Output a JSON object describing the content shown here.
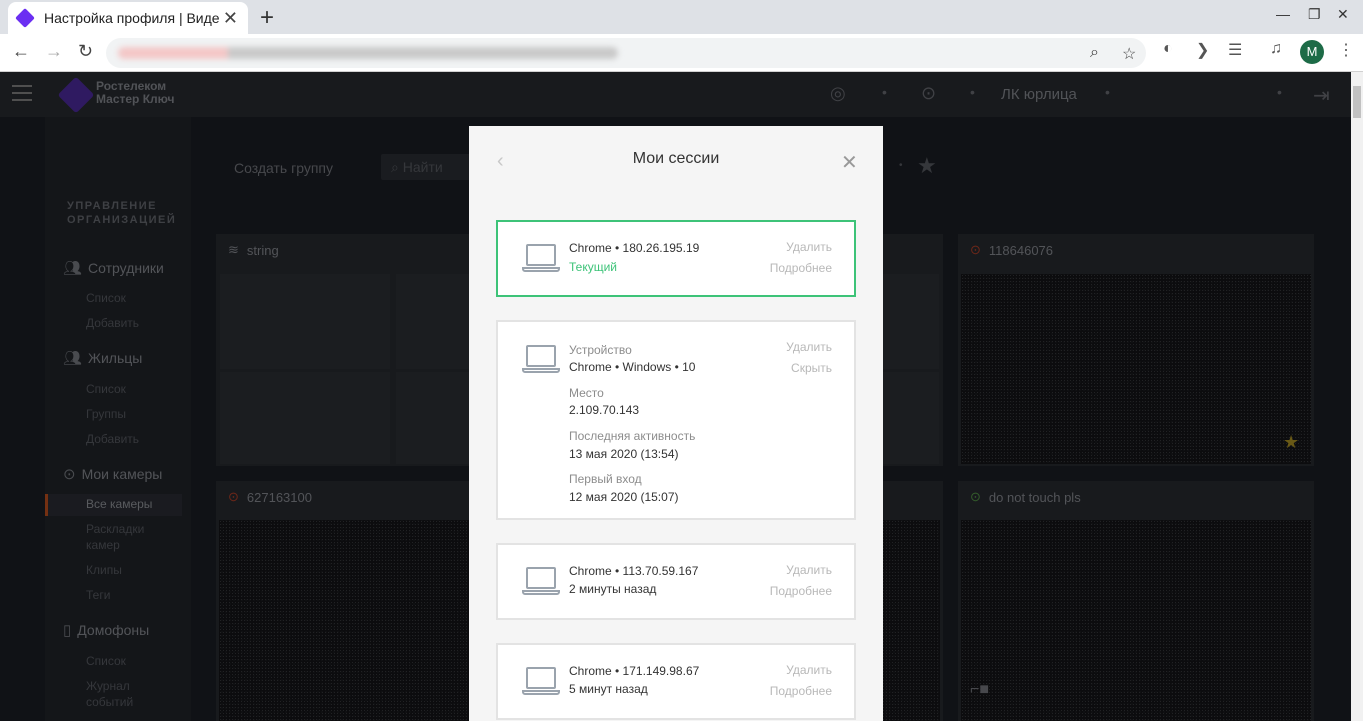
{
  "browser": {
    "tab_title": "Настройка профиля | Видеонаблюдение",
    "tab_close": "✕",
    "new_tab": "+",
    "account_initial": "M"
  },
  "app": {
    "logo_line1": "Ростелеком",
    "logo_line2": "Мастер Ключ",
    "org_label": "ЛК юрлица",
    "header_icons": [
      "support-icon",
      "camera-icon",
      "logout-icon"
    ]
  },
  "sidebar": {
    "section_title_1": "УПРАВЛЕНИЕ",
    "section_title_2": "ОРГАНИЗАЦИЕЙ",
    "employees": {
      "label": "Сотрудники",
      "items": [
        "Список",
        "Добавить"
      ]
    },
    "residents": {
      "label": "Жильцы",
      "items": [
        "Список",
        "Группы",
        "Добавить"
      ]
    },
    "cameras": {
      "label": "Мои камеры",
      "items": [
        "Все камеры",
        "Раскладки",
        "камер",
        "Клипы",
        "Теги"
      ]
    },
    "intercoms": {
      "label": "Домофоны",
      "items": [
        "Список",
        "Журнал",
        "событий"
      ]
    }
  },
  "main": {
    "create_group": "Создать группу",
    "search_placeholder": "Найти",
    "cards": [
      {
        "title": "string"
      },
      {
        "title": "118646076"
      },
      {
        "title": "627163100"
      },
      {
        "title": "do not touch pls"
      }
    ]
  },
  "modal": {
    "title": "Мои сессии",
    "back": "‹",
    "close": "✕",
    "sessions": [
      {
        "line1": "Chrome • 180.26.195.19",
        "status": "Текущий",
        "action1": "Удалить",
        "action2": "Подробнее"
      },
      {
        "device_label": "Устройство",
        "device": "Chrome • Windows • 10",
        "place_label": "Место",
        "place": "2.109.70.143",
        "last_label": "Последняя активность",
        "last": "13 мая 2020 (13:54)",
        "first_label": "Первый вход",
        "first": "12 мая 2020 (15:07)",
        "action1": "Удалить",
        "action2": "Скрыть"
      },
      {
        "line1": "Chrome • 113.70.59.167",
        "line2": "2 минуты назад",
        "action1": "Удалить",
        "action2": "Подробнее"
      },
      {
        "line1": "Chrome • 171.149.98.67",
        "line2": "5 минут назад",
        "action1": "Удалить",
        "action2": "Подробнее"
      }
    ]
  },
  "colors": {
    "accent_green": "#3dc378",
    "active_marker": "#c9541f",
    "star": "#b59a27",
    "brand_purple": "#6b2ff2"
  }
}
